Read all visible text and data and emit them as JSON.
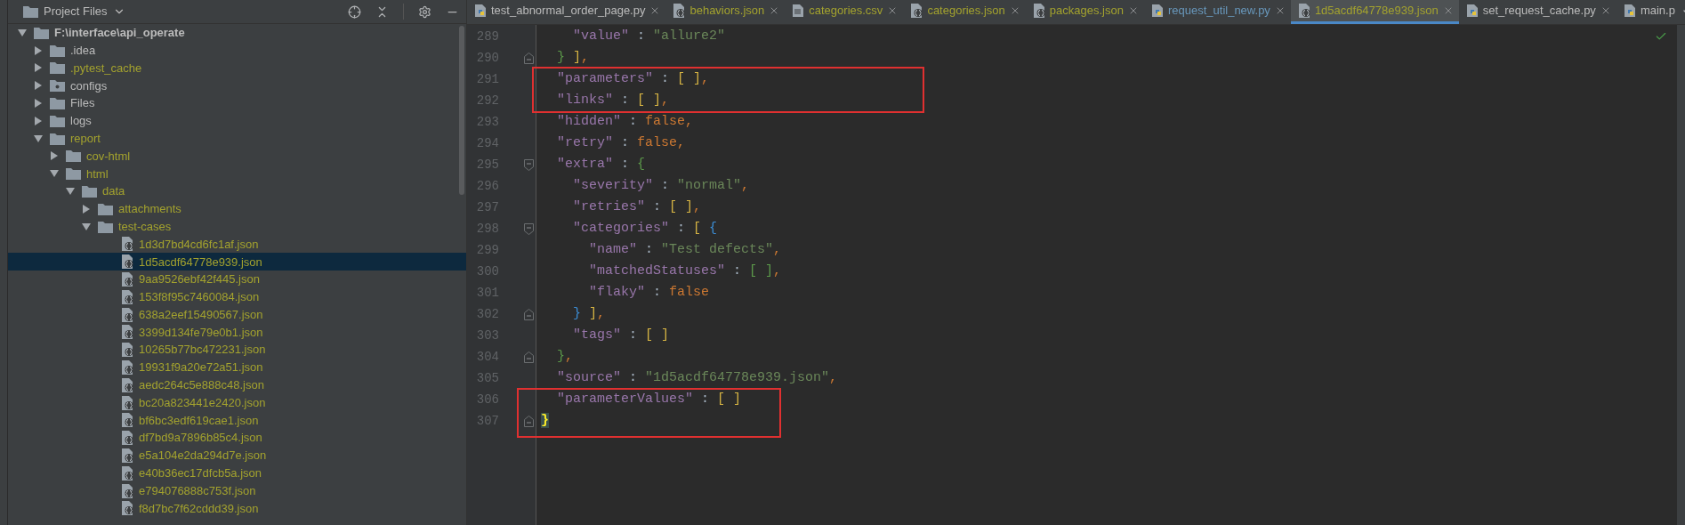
{
  "project_panel": {
    "title": "Project Files",
    "tree": [
      {
        "name": "F:\\interface\\api_operate",
        "kind": "folder",
        "expanded": true,
        "ignored": false,
        "selected": false,
        "children": [
          {
            "name": ".idea",
            "kind": "folder",
            "expanded": false,
            "ignored": false,
            "selected": false
          },
          {
            "name": ".pytest_cache",
            "kind": "folder",
            "expanded": false,
            "ignored": true,
            "selected": false
          },
          {
            "name": "configs",
            "kind": "package",
            "expanded": false,
            "ignored": false,
            "selected": false
          },
          {
            "name": "Files",
            "kind": "folder",
            "expanded": false,
            "ignored": false,
            "selected": false
          },
          {
            "name": "logs",
            "kind": "folder",
            "expanded": false,
            "ignored": false,
            "selected": false
          },
          {
            "name": "report",
            "kind": "folder",
            "expanded": true,
            "ignored": true,
            "selected": false,
            "children": [
              {
                "name": "cov-html",
                "kind": "folder",
                "expanded": false,
                "ignored": true,
                "selected": false
              },
              {
                "name": "html",
                "kind": "folder",
                "expanded": true,
                "ignored": true,
                "selected": false,
                "children": [
                  {
                    "name": "data",
                    "kind": "folder",
                    "expanded": true,
                    "ignored": true,
                    "selected": false,
                    "children": [
                      {
                        "name": "attachments",
                        "kind": "folder",
                        "expanded": false,
                        "ignored": true,
                        "selected": false
                      },
                      {
                        "name": "test-cases",
                        "kind": "folder",
                        "expanded": true,
                        "ignored": true,
                        "selected": false,
                        "children": [
                          {
                            "name": "1d3d7bd4cd6fc1af.json",
                            "kind": "file",
                            "ignored": true,
                            "selected": false
                          },
                          {
                            "name": "1d5acdf64778e939.json",
                            "kind": "file",
                            "ignored": true,
                            "selected": true
                          },
                          {
                            "name": "9aa9526ebf42f445.json",
                            "kind": "file",
                            "ignored": true,
                            "selected": false
                          },
                          {
                            "name": "153f8f95c7460084.json",
                            "kind": "file",
                            "ignored": true,
                            "selected": false
                          },
                          {
                            "name": "638a2eef15490567.json",
                            "kind": "file",
                            "ignored": true,
                            "selected": false
                          },
                          {
                            "name": "3399d134fe79e0b1.json",
                            "kind": "file",
                            "ignored": true,
                            "selected": false
                          },
                          {
                            "name": "10265b77bc472231.json",
                            "kind": "file",
                            "ignored": true,
                            "selected": false
                          },
                          {
                            "name": "19931f9a20e72a51.json",
                            "kind": "file",
                            "ignored": true,
                            "selected": false
                          },
                          {
                            "name": "aedc264c5e888c48.json",
                            "kind": "file",
                            "ignored": true,
                            "selected": false
                          },
                          {
                            "name": "bc20a823441e2420.json",
                            "kind": "file",
                            "ignored": true,
                            "selected": false
                          },
                          {
                            "name": "bf6bc3edf619cae1.json",
                            "kind": "file",
                            "ignored": true,
                            "selected": false
                          },
                          {
                            "name": "df7bd9a7896b85c4.json",
                            "kind": "file",
                            "ignored": true,
                            "selected": false
                          },
                          {
                            "name": "e5a104e2da294d7e.json",
                            "kind": "file",
                            "ignored": true,
                            "selected": false
                          },
                          {
                            "name": "e40b36ec17dfcb5a.json",
                            "kind": "file",
                            "ignored": true,
                            "selected": false
                          },
                          {
                            "name": "e794076888c753f.json",
                            "kind": "file",
                            "ignored": true,
                            "selected": false
                          },
                          {
                            "name": "f8d7bc7f62cddd39.json",
                            "kind": "file",
                            "ignored": true,
                            "selected": false
                          }
                        ]
                      }
                    ]
                  }
                ]
              }
            ]
          }
        ]
      }
    ]
  },
  "tabs": [
    {
      "label": "test_abnormal_order_page.py",
      "kind": "python",
      "color": "#bbbbbb",
      "selected": false
    },
    {
      "label": "behaviors.json",
      "kind": "json",
      "color": "#a3a22e",
      "selected": false
    },
    {
      "label": "categories.csv",
      "kind": "csv",
      "color": "#a3a22e",
      "selected": false
    },
    {
      "label": "categories.json",
      "kind": "json",
      "color": "#a3a22e",
      "selected": false
    },
    {
      "label": "packages.json",
      "kind": "json",
      "color": "#a3a22e",
      "selected": false
    },
    {
      "label": "request_util_new.py",
      "kind": "python",
      "color": "#6897bb",
      "selected": false
    },
    {
      "label": "1d5acdf64778e939.json",
      "kind": "json",
      "color": "#a3a22e",
      "selected": true
    },
    {
      "label": "set_request_cache.py",
      "kind": "python",
      "color": "#bbbbbb",
      "selected": false
    },
    {
      "label": "main.p",
      "kind": "python",
      "color": "#bbbbbb",
      "selected": false
    }
  ],
  "editor": {
    "lines": [
      {
        "number": "289",
        "tokens": [
          {
            "text": "    \"value\"",
            "kind": "key"
          },
          {
            "text": " : ",
            "kind": "punct"
          },
          {
            "text": "\"allure2\"",
            "kind": "string"
          }
        ]
      },
      {
        "number": "290",
        "fold_marker": {
          "kind": "close"
        },
        "tokens": [
          {
            "text": "  }",
            "kind": "bracket",
            "color": "#5c9a4a"
          },
          {
            "text": " ]",
            "kind": "bracket",
            "color": "#d5b343"
          },
          {
            "text": ",",
            "kind": "comma"
          }
        ]
      },
      {
        "number": "291",
        "tokens": [
          {
            "text": "  \"parameters\"",
            "kind": "key"
          },
          {
            "text": " : ",
            "kind": "punct"
          },
          {
            "text": "[ ]",
            "kind": "bracket",
            "color": "#d5b343"
          },
          {
            "text": ",",
            "kind": "comma"
          }
        ]
      },
      {
        "number": "292",
        "tokens": [
          {
            "text": "  \"links\"",
            "kind": "key"
          },
          {
            "text": " : ",
            "kind": "punct"
          },
          {
            "text": "[ ]",
            "kind": "bracket",
            "color": "#d5b343"
          },
          {
            "text": ",",
            "kind": "comma"
          }
        ]
      },
      {
        "number": "293",
        "tokens": [
          {
            "text": "  \"hidden\"",
            "kind": "key"
          },
          {
            "text": " : ",
            "kind": "punct"
          },
          {
            "text": "false",
            "kind": "literal"
          },
          {
            "text": ",",
            "kind": "comma"
          }
        ]
      },
      {
        "number": "294",
        "tokens": [
          {
            "text": "  \"retry\"",
            "kind": "key"
          },
          {
            "text": " : ",
            "kind": "punct"
          },
          {
            "text": "false",
            "kind": "literal"
          },
          {
            "text": ",",
            "kind": "comma"
          }
        ]
      },
      {
        "number": "295",
        "fold_marker": {
          "kind": "open"
        },
        "tokens": [
          {
            "text": "  \"extra\"",
            "kind": "key"
          },
          {
            "text": " : ",
            "kind": "punct"
          },
          {
            "text": "{",
            "kind": "bracket",
            "color": "#5c9a4a"
          }
        ]
      },
      {
        "number": "296",
        "tokens": [
          {
            "text": "    \"severity\"",
            "kind": "key"
          },
          {
            "text": " : ",
            "kind": "punct"
          },
          {
            "text": "\"normal\"",
            "kind": "string"
          },
          {
            "text": ",",
            "kind": "comma"
          }
        ]
      },
      {
        "number": "297",
        "tokens": [
          {
            "text": "    \"retries\"",
            "kind": "key"
          },
          {
            "text": " : ",
            "kind": "punct"
          },
          {
            "text": "[ ]",
            "kind": "bracket",
            "color": "#d5b343"
          },
          {
            "text": ",",
            "kind": "comma"
          }
        ]
      },
      {
        "number": "298",
        "fold_marker": {
          "kind": "open"
        },
        "tokens": [
          {
            "text": "    \"categories\"",
            "kind": "key"
          },
          {
            "text": " : ",
            "kind": "punct"
          },
          {
            "text": "[",
            "kind": "bracket",
            "color": "#d5b343"
          },
          {
            "text": " {",
            "kind": "bracket",
            "color": "#3c8fd8"
          }
        ]
      },
      {
        "number": "299",
        "tokens": [
          {
            "text": "      \"name\"",
            "kind": "key"
          },
          {
            "text": " : ",
            "kind": "punct"
          },
          {
            "text": "\"Test defects\"",
            "kind": "string"
          },
          {
            "text": ",",
            "kind": "comma"
          }
        ]
      },
      {
        "number": "300",
        "tokens": [
          {
            "text": "      \"matchedStatuses\"",
            "kind": "key"
          },
          {
            "text": " : ",
            "kind": "punct"
          },
          {
            "text": "[ ]",
            "kind": "bracket",
            "color": "#5c9a4a"
          },
          {
            "text": ",",
            "kind": "comma"
          }
        ]
      },
      {
        "number": "301",
        "tokens": [
          {
            "text": "      \"flaky\"",
            "kind": "key"
          },
          {
            "text": " : ",
            "kind": "punct"
          },
          {
            "text": "false",
            "kind": "literal"
          }
        ]
      },
      {
        "number": "302",
        "fold_marker": {
          "kind": "close"
        },
        "tokens": [
          {
            "text": "    }",
            "kind": "bracket",
            "color": "#3c8fd8"
          },
          {
            "text": " ]",
            "kind": "bracket",
            "color": "#d5b343"
          },
          {
            "text": ",",
            "kind": "comma"
          }
        ]
      },
      {
        "number": "303",
        "tokens": [
          {
            "text": "    \"tags\"",
            "kind": "key"
          },
          {
            "text": " : ",
            "kind": "punct"
          },
          {
            "text": "[ ]",
            "kind": "bracket",
            "color": "#d5b343"
          }
        ]
      },
      {
        "number": "304",
        "fold_marker": {
          "kind": "close"
        },
        "tokens": [
          {
            "text": "  }",
            "kind": "bracket",
            "color": "#5c9a4a"
          },
          {
            "text": ",",
            "kind": "comma"
          }
        ]
      },
      {
        "number": "305",
        "tokens": [
          {
            "text": "  \"source\"",
            "kind": "key"
          },
          {
            "text": " : ",
            "kind": "punct"
          },
          {
            "text": "\"1d5acdf64778e939.json\"",
            "kind": "string"
          },
          {
            "text": ",",
            "kind": "comma"
          }
        ]
      },
      {
        "number": "306",
        "tokens": [
          {
            "text": "  \"parameterValues\"",
            "kind": "key"
          },
          {
            "text": " : ",
            "kind": "punct"
          },
          {
            "text": "[ ]",
            "kind": "bracket",
            "color": "#d5b343"
          }
        ]
      },
      {
        "number": "307",
        "fold_marker": {
          "kind": "close"
        },
        "tokens": [
          {
            "text": "}",
            "kind": "matched-bracket"
          }
        ]
      }
    ]
  }
}
